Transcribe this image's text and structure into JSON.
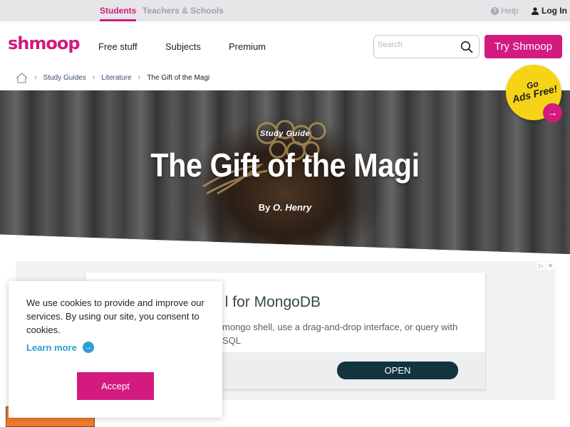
{
  "audience_tabs": {
    "students": "Students",
    "teachers": "Teachers & Schools"
  },
  "utility": {
    "help": "Help",
    "login": "Log In"
  },
  "header": {
    "logo": "shmoop",
    "nav": [
      "Free stuff",
      "Subjects",
      "Premium"
    ],
    "search_placeholder": "Search",
    "cta": "Try Shmoop"
  },
  "breadcrumb": [
    "Study Guides",
    "Literature",
    "The Gift of the Magi"
  ],
  "hero": {
    "kicker": "Study Guide",
    "title": "The Gift of the Magi",
    "by": "By",
    "author": "O. Henry"
  },
  "badge": {
    "line1": "Go",
    "line2": "Ads Free!"
  },
  "ad": {
    "title": "l for MongoDB",
    "description": "mongo shell, use a drag-and-drop interface, or query with SQL",
    "button": "OPEN"
  },
  "cookie": {
    "message": "We use cookies to provide and improve our services. By using our site, you consent to cookies.",
    "learn_more": "Learn more",
    "accept": "Accept"
  },
  "colors": {
    "brand": "#d21a7f",
    "badge": "#f5d418",
    "link": "#2a9fd6",
    "ad_button": "#12343f"
  }
}
